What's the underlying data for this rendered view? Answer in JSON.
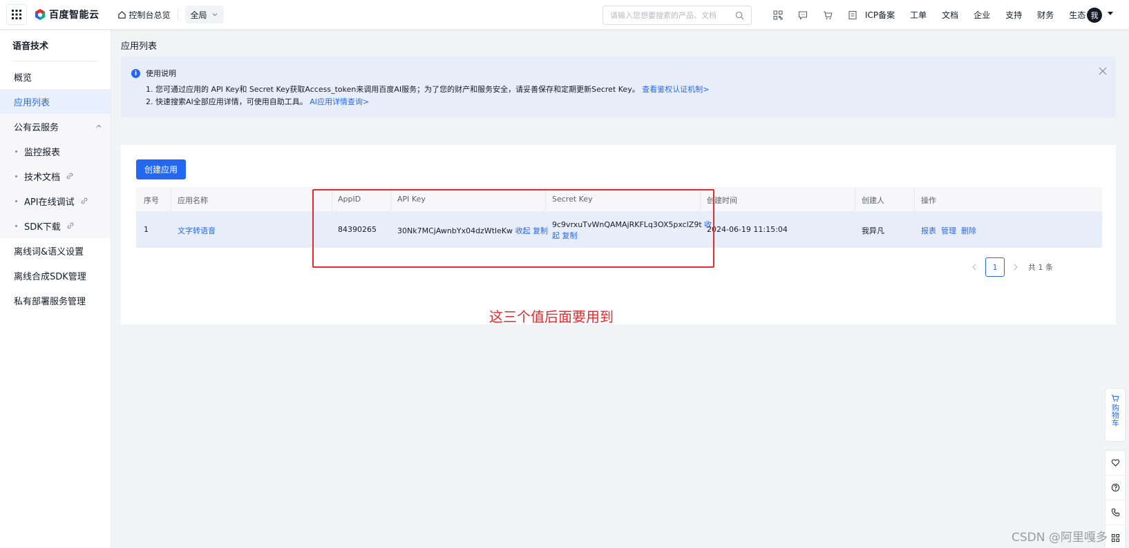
{
  "topbar": {
    "logo_text": "百度智能云",
    "console_label": "控制台总览",
    "region_label": "全局",
    "search_placeholder": "请输入您想要搜索的产品、文档",
    "menu": [
      "ICP备案",
      "工单",
      "文档",
      "企业",
      "支持",
      "财务",
      "生态"
    ],
    "avatar_text": "我",
    "icons": [
      "qrcode-icon",
      "message-icon",
      "cart-icon",
      "billing-icon"
    ]
  },
  "sidebar": {
    "title": "语音技术",
    "items": [
      {
        "label": "概览",
        "active": false
      },
      {
        "label": "应用列表",
        "active": true
      },
      {
        "label": "公有云服务",
        "expanded": true
      }
    ],
    "sub_items": [
      {
        "label": "监控报表",
        "external": false
      },
      {
        "label": "技术文档",
        "external": true
      },
      {
        "label": "API在线调试",
        "external": true
      },
      {
        "label": "SDK下载",
        "external": true
      }
    ],
    "bottom_items": [
      {
        "label": "离线词&语义设置"
      },
      {
        "label": "离线合成SDK管理"
      },
      {
        "label": "私有部署服务管理"
      }
    ]
  },
  "main": {
    "page_title": "应用列表",
    "notice": {
      "title": "使用说明",
      "line1_text": "1. 您可通过应用的 API Key和 Secret Key获取Access_token来调用百度AI服务；为了您的财产和服务安全，请妥善保存和定期更新Secret Key。",
      "line1_link": "查看鉴权认证机制>",
      "line2_text": "2. 快速搜索AI全部应用详情，可使用自助工具。",
      "line2_link": "AI应用详情查询>"
    },
    "create_button": "创建应用",
    "table": {
      "headers": [
        "序号",
        "应用名称",
        "AppID",
        "API Key",
        "Secret Key",
        "创建时间",
        "创建人",
        "操作"
      ],
      "rows": [
        {
          "index": "1",
          "app_name": "文字转语音",
          "app_id": "84390265",
          "api_key": "30Nk7MCjAwnbYx04dzWtleKw",
          "api_key_collapse": "收起",
          "api_key_copy": "复制",
          "secret_key": "9c9vrxuTvWnQAMAjRKFLq3OX5pxclZ9t",
          "secret_key_collapse_1": "收",
          "secret_key_collapse_2": "起",
          "secret_key_copy": "复制",
          "created_at": "2024-06-19 11:15:04",
          "creator": "我异凡",
          "actions": [
            "报表",
            "管理",
            "删除"
          ]
        }
      ]
    },
    "pagination": {
      "current_page": "1",
      "total": "共 1 条"
    }
  },
  "annotation": "这三个值后面要用到",
  "float_bar": {
    "cart_label": "购物车",
    "tools": [
      "heart-icon",
      "help-icon",
      "phone-icon",
      "grid-icon"
    ]
  },
  "watermark": "CSDN @阿里嘎多",
  "colors": {
    "primary": "#2468f2",
    "annotation_red": "#e8282b",
    "notice_bg": "#e8eef9",
    "row_highlight": "#e8eef9"
  }
}
